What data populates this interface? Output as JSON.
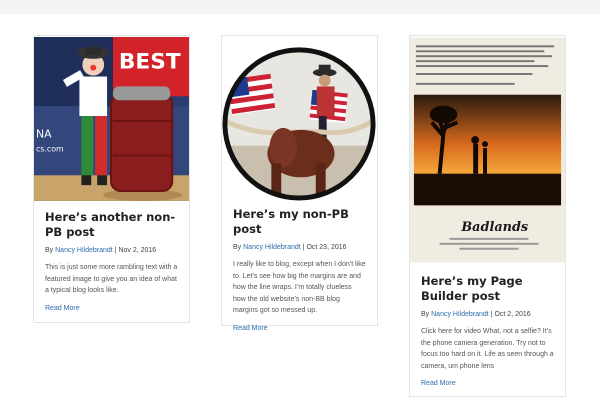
{
  "posts": [
    {
      "title": "Here’s another non-PB post",
      "by": "By",
      "author": "Nancy Hildebrandt",
      "sep": "|",
      "date": "Nov 2, 2016",
      "excerpt": "This is just some more rambling text with a featured image to give you an idea of what a typical blog looks like.",
      "read_more": "Read More",
      "image_text": "BEST"
    },
    {
      "title": "Here’s my non-PB post",
      "by": "By",
      "author": "Nancy Hildebrandt",
      "sep": "|",
      "date": "Oct 23, 2016",
      "excerpt": "I really like to blog, except when I don’t like to. Let’s see how big the margins are and how the line wraps. I’m totally clueless how the old website’s non-BB blog margins got so messed up.",
      "read_more": "Read More"
    },
    {
      "title": "Here’s my Page Builder post",
      "by": "By",
      "author": "Nancy Hildebrandt",
      "sep": "|",
      "date": "Oct 2, 2016",
      "excerpt": "Click here for video What, not a selfie? It’s the phone camera generation. Try not to focus too hard on it. Life as seen through a camera, um phone lens",
      "read_more": "Read More",
      "image_text": "Badlands"
    }
  ],
  "colors": {
    "link": "#2b6cb0",
    "card_border": "#e4e4e4"
  }
}
